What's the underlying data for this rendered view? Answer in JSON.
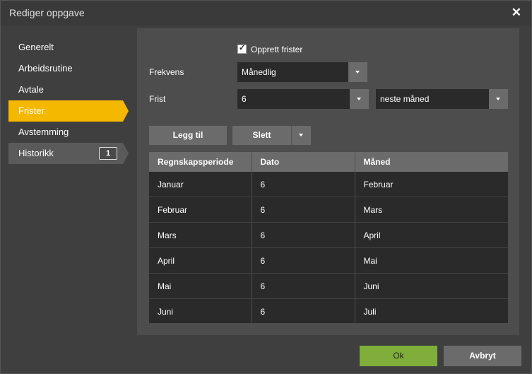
{
  "dialog": {
    "title": "Rediger oppgave",
    "close_symbol": "✕"
  },
  "sidebar": {
    "items": [
      {
        "label": "Generelt"
      },
      {
        "label": "Arbeidsrutine"
      },
      {
        "label": "Avtale"
      },
      {
        "label": "Frister",
        "active": true
      },
      {
        "label": "Avstemming"
      },
      {
        "label": "Historikk",
        "badge": "1"
      }
    ]
  },
  "form": {
    "create_deadlines_label": "Opprett frister",
    "create_deadlines_checked": true,
    "frequency_label": "Frekvens",
    "frequency_value": "Månedlig",
    "deadline_label": "Frist",
    "deadline_day_value": "6",
    "deadline_month_value": "neste måned"
  },
  "toolbar": {
    "add_label": "Legg til",
    "delete_label": "Slett"
  },
  "grid": {
    "columns": [
      "Regnskapsperiode",
      "Dato",
      "Måned"
    ],
    "rows": [
      [
        "Januar",
        "6",
        "Februar"
      ],
      [
        "Februar",
        "6",
        "Mars"
      ],
      [
        "Mars",
        "6",
        "April"
      ],
      [
        "April",
        "6",
        "Mai"
      ],
      [
        "Mai",
        "6",
        "Juni"
      ],
      [
        "Juni",
        "6",
        "Juli"
      ]
    ]
  },
  "footer": {
    "ok_label": "Ok",
    "cancel_label": "Avbryt"
  },
  "colors": {
    "accent": "#f5b800",
    "ok_button": "#7fae3b",
    "panel": "#4d4d4d",
    "field": "#2a2a2a"
  }
}
